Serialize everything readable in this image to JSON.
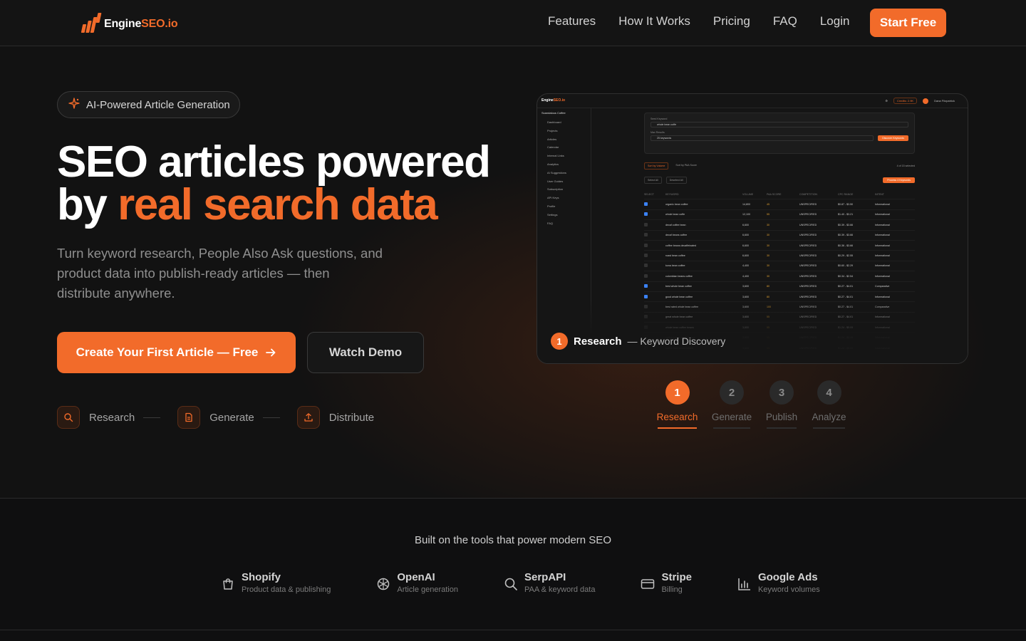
{
  "nav": {
    "brand_main": "Engine",
    "brand_accent": "SEO.io",
    "links": [
      "Features",
      "How It Works",
      "Pricing",
      "FAQ",
      "Login"
    ],
    "cta": "Start Free"
  },
  "hero": {
    "badge": "AI-Powered Article Generation",
    "headline_line1": "SEO articles powered",
    "headline_by": "by ",
    "headline_accent": "real search data",
    "subtext": "Turn keyword research, People Also Ask questions, and product data into publish-ready articles — then distribute anywhere.",
    "primary_cta": "Create Your First Article — Free",
    "secondary_cta": "Watch Demo",
    "mini_steps": [
      "Research",
      "Generate",
      "Distribute"
    ]
  },
  "preview": {
    "app_brand_main": "Engine",
    "app_brand_accent": "SEO.io",
    "credits": "Credits: 2.9K",
    "user": "Dana Fitzpatrick",
    "store": "Scandalous Coffee",
    "sidebar": [
      "Dashboard",
      "Projects",
      "Articles",
      "Calendar",
      "Internal Links",
      "Analytics",
      "AI Suggestions",
      "User Guides",
      "Subscription",
      "API Keys",
      "Profile",
      "Settings",
      "FAQ"
    ],
    "seed_label": "Seed Keyword",
    "seed_value": "whole bean coffe",
    "max_label": "Max Results",
    "max_value": "25 keywords",
    "discover_btn": "Discover Keywords",
    "sort_volume": "Sort by Volume",
    "sort_paa": "Sort by PAA Score",
    "select_all": "Select All",
    "deselect_all": "Deselect All",
    "process_btn": "Process 4 Keywords",
    "selected_count": "4 of 15 selected",
    "columns": [
      "SELECT",
      "KEYWORD",
      "VOLUME",
      "PAA SCORE",
      "COMPETITION",
      "CPC RANGE",
      "INTENT"
    ],
    "rows": [
      [
        "organic bean coffee",
        "14,800",
        "45",
        "UNSPECIFIED",
        "$0.87 - $3.50",
        "Informational"
      ],
      [
        "whole bean coffe",
        "12,100",
        "55",
        "UNSPECIFIED",
        "$1.40 - $3.21",
        "Informational"
      ],
      [
        "decaf coffee bean",
        "6,600",
        "30",
        "UNSPECIFIED",
        "$0.39 - $3.66",
        "Informational"
      ],
      [
        "decaf beans coffee",
        "6,600",
        "30",
        "UNSPECIFIED",
        "$0.39 - $3.66",
        "Informational"
      ],
      [
        "coffee beans decaffeinated",
        "6,600",
        "30",
        "UNSPECIFIED",
        "$0.36 - $3.66",
        "Informational"
      ],
      [
        "roast bean coffee",
        "6,600",
        "30",
        "UNSPECIFIED",
        "$0.29 - $2.55",
        "Informational"
      ],
      [
        "kona bean coffee",
        "4,400",
        "30",
        "UNSPECIFIED",
        "$0.60 - $2.29",
        "Informational"
      ],
      [
        "colombian beans coffee",
        "4,400",
        "30",
        "UNSPECIFIED",
        "$0.34 - $2.54",
        "Informational"
      ],
      [
        "best whole bean coffee",
        "3,600",
        "80",
        "UNSPECIFIED",
        "$0.27 - $4.01",
        "Comparative"
      ],
      [
        "good whole bean coffee",
        "3,600",
        "80",
        "UNSPECIFIED",
        "$0.27 - $4.01",
        "Informational"
      ],
      [
        "best rated whole bean coffee",
        "3,600",
        "100",
        "UNSPECIFIED",
        "$0.27 - $4.01",
        "Comparative"
      ],
      [
        "great whole bean coffee",
        "3,600",
        "55",
        "UNSPECIFIED",
        "$0.27 - $4.01",
        "Informational"
      ],
      [
        "whole bean coffee beans",
        "3,600",
        "55",
        "UNSPECIFIED",
        "$1.24 - $5.09",
        "Informational"
      ],
      [
        "coffee beans whole beans",
        "3,600",
        "55",
        "UNSPECIFIED",
        "$1.24 - $5.09",
        "Informational"
      ],
      [
        "coffee from whole beans",
        "3,600",
        "55",
        "UNSPECIFIED",
        "$1.24 - $5.09",
        "Informational"
      ]
    ],
    "caption_num": "1",
    "caption_title": "Research",
    "caption_sub": "— Keyword Discovery"
  },
  "tabs": [
    {
      "num": "1",
      "label": "Research"
    },
    {
      "num": "2",
      "label": "Generate"
    },
    {
      "num": "3",
      "label": "Publish"
    },
    {
      "num": "4",
      "label": "Analyze"
    }
  ],
  "built_on": {
    "title": "Built on the tools that power modern SEO",
    "partners": [
      {
        "name": "Shopify",
        "desc": "Product data & publishing",
        "icon": "shopping-bag-icon"
      },
      {
        "name": "OpenAI",
        "desc": "Article generation",
        "icon": "openai-icon"
      },
      {
        "name": "SerpAPI",
        "desc": "PAA & keyword data",
        "icon": "search-icon"
      },
      {
        "name": "Stripe",
        "desc": "Billing",
        "icon": "credit-card-icon"
      },
      {
        "name": "Google Ads",
        "desc": "Keyword volumes",
        "icon": "bar-chart-icon"
      }
    ]
  },
  "colors": {
    "accent": "#f26b2a",
    "background": "#121212"
  }
}
